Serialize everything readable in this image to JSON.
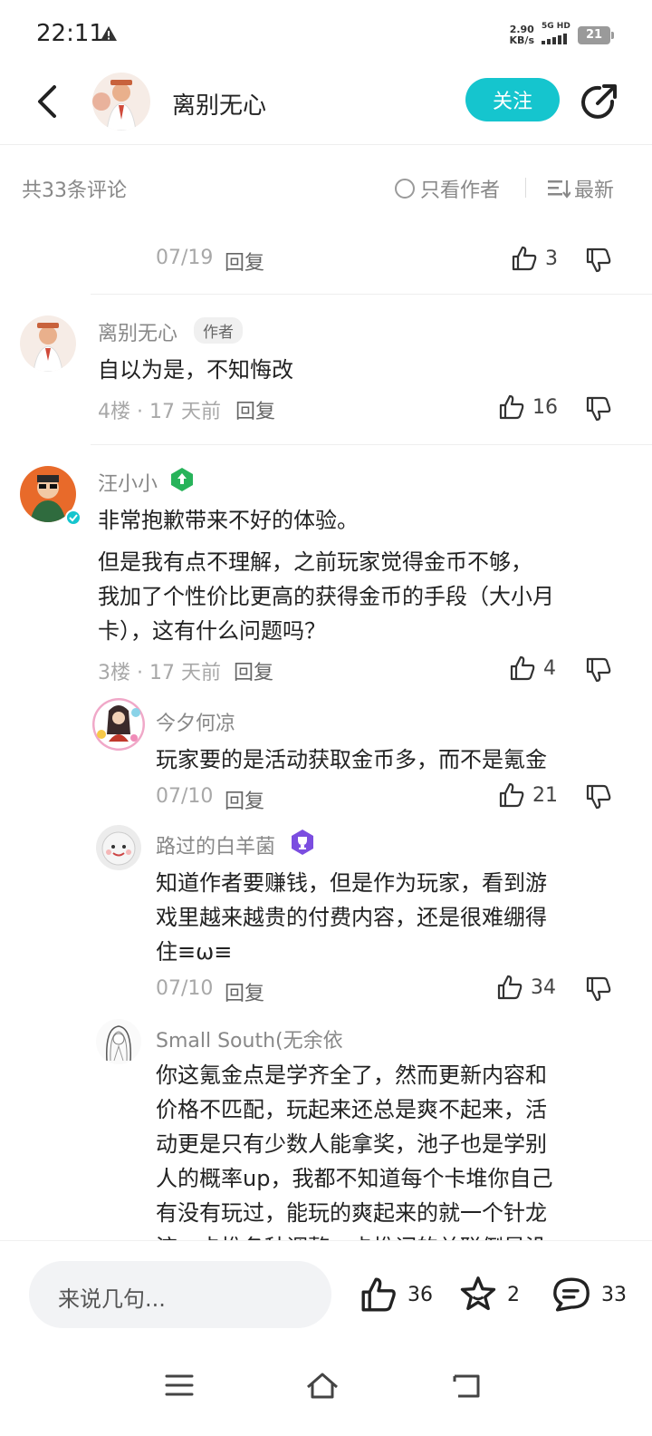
{
  "status_bar": {
    "time": "22:11",
    "net_speed_top": "2.90",
    "net_speed_bottom": "KB/s",
    "network_top": "5G HD",
    "battery": "21"
  },
  "header": {
    "title": "离别无心",
    "follow_label": "关注"
  },
  "filter": {
    "count_label": "共33条评论",
    "author_only_label": "只看作者",
    "sort_label": "最新"
  },
  "comments": [
    {
      "date": "07/19",
      "reply_label": "回复",
      "likes": "3"
    },
    {
      "name": "离别无心",
      "tag": "作者",
      "text": "自以为是，不知悔改",
      "floor": "4楼 · 17 天前",
      "reply_label": "回复",
      "likes": "16"
    },
    {
      "name": "汪小小",
      "text_line1": "非常抱歉带来不好的体验。",
      "text_line2": "但是我有点不理解，之前玩家觉得金币不够，",
      "text_line3": "我加了个性价比更高的获得金币的手段（大小月",
      "text_line4": "卡），这有什么问题吗？",
      "floor": "3楼 · 17 天前",
      "reply_label": "回复",
      "likes": "4",
      "replies": [
        {
          "name": "今夕何凉",
          "text": "玩家要的是活动获取金币多，而不是氪金",
          "date": "07/10",
          "reply_label": "回复",
          "likes": "21"
        },
        {
          "name": "路过的白羊菌",
          "line1": "知道作者要赚钱，但是作为玩家，看到游",
          "line2": "戏里越来越贵的付费内容，还是很难绷得",
          "line3": "住≡ω≡",
          "date": "07/10",
          "reply_label": "回复",
          "likes": "34"
        },
        {
          "name": "Small South(无余依",
          "line1": "你这氪金点是学齐全了，然而更新内容和",
          "line2": "价格不匹配，玩起来还总是爽不起来，活",
          "line3": "动更是只有少数人能拿奖，池子也是学别",
          "line4": "人的概率up，我都不知道每个卡堆你自己",
          "line5": "有没有玩过，能玩的爽起来的就一个针龙",
          "line6": "流，卡推各种调整，卡推词的关联倒是没"
        }
      ]
    }
  ],
  "bottom_bar": {
    "input_placeholder": "来说几句...",
    "likes": "36",
    "stars": "2",
    "comments": "33"
  },
  "colors": {
    "accent": "#15c5ce",
    "meta_gray": "#a8a8a8",
    "text": "#222222"
  }
}
